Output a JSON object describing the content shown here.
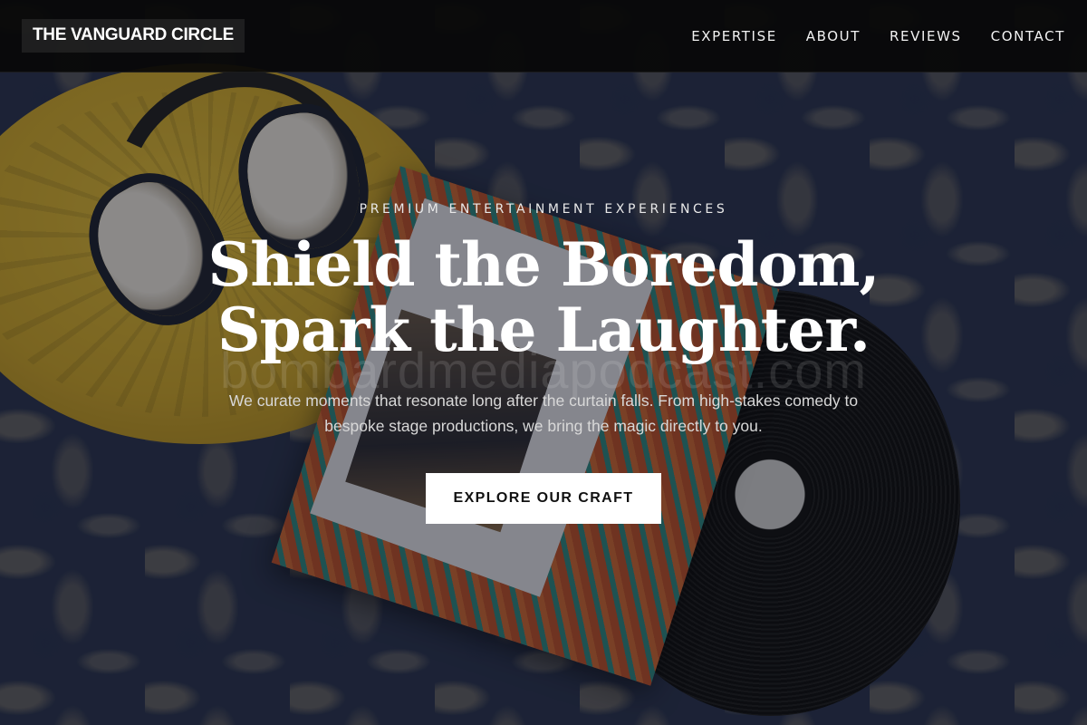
{
  "brand": {
    "name": "THE VANGUARD CIRCLE"
  },
  "nav": {
    "items": [
      {
        "label": "EXPERTISE"
      },
      {
        "label": "ABOUT"
      },
      {
        "label": "REVIEWS"
      },
      {
        "label": "CONTACT"
      }
    ]
  },
  "hero": {
    "eyebrow": "PREMIUM ENTERTAINMENT EXPERIENCES",
    "headline_line1": "Shield the Boredom,",
    "headline_line2": "Spark the Laughter.",
    "watermark": "bombardmediapodcast.com",
    "subtext": "We curate moments that resonate long after the curtain falls. From high-stakes comedy to bespoke stage productions, we bring the magic directly to you.",
    "cta_label": "EXPLORE OUR CRAFT"
  },
  "colors": {
    "header_bg": "#080808",
    "text_primary": "#ffffff",
    "cta_bg": "#ffffff",
    "cta_text": "#111111",
    "pillow_yellow": "#d6ad2a",
    "rug_navy": "#2a3450"
  },
  "background_image": {
    "subject": "headphones on yellow pillow with vinyl record and album sleeve on patterned rug"
  }
}
